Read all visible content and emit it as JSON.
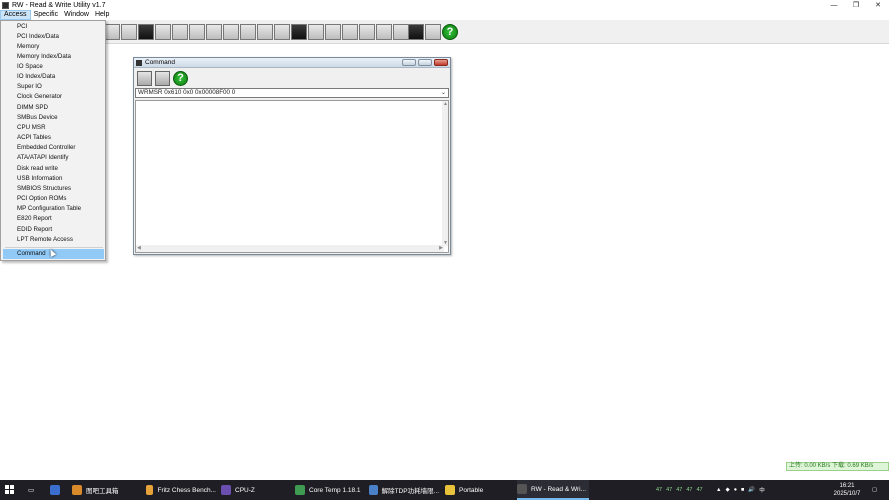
{
  "window": {
    "title": "RW - Read & Write Utility v1.7",
    "controls": {
      "minimize": "—",
      "restore": "❐",
      "close": "✕"
    }
  },
  "menubar": {
    "items": [
      "Access",
      "Specific",
      "Window",
      "Help"
    ],
    "active": "Access"
  },
  "access_menu": {
    "items": [
      "PCI",
      "PCI Index/Data",
      "Memory",
      "Memory Index/Data",
      "IO Space",
      "IO Index/Data",
      "Super IO",
      "Clock Generator",
      "DIMM SPD",
      "SMBus Device",
      "CPU MSR",
      "ACPI Tables",
      "Embedded Controller",
      "ATA/ATAPI Identify",
      "Disk read write",
      "USB Information",
      "SMBIOS Structures",
      "PCI Option ROMs",
      "MP Configuration Table",
      "E820 Report",
      "EDID Report",
      "LPT Remote Access",
      "Command"
    ],
    "selected": "Command"
  },
  "command_window": {
    "title": "Command",
    "input_value": "WRMSR 0x610 0x0 0x00008F00 0",
    "help_glyph": "?"
  },
  "toolbar": {
    "help_glyph": "?"
  },
  "status": {
    "net_speed": "上传: 0.00 KB/s   下载: 0.69 KB/s"
  },
  "taskbar": {
    "tasks": [
      {
        "label": "图吧工具箱",
        "color": "#d98a2b"
      },
      {
        "label": "Fritz Chess Bench...",
        "color": "#e8a23a"
      },
      {
        "label": "CPU-Z",
        "color": "#6a4fb0"
      },
      {
        "label": "Core Temp 1.18.1",
        "color": "#3f9a52"
      },
      {
        "label": "解除TDP功耗墙限...",
        "color": "#4a7fc9"
      },
      {
        "label": "Portable",
        "color": "#e8c23a"
      },
      {
        "label": "RW - Read & Wri...",
        "color": "#3a3a3a"
      }
    ],
    "tray_temps": [
      "47",
      "47",
      "47",
      "47",
      "47"
    ],
    "ime": "中",
    "clock_time": "16:21",
    "clock_date": "2025/10/7"
  }
}
